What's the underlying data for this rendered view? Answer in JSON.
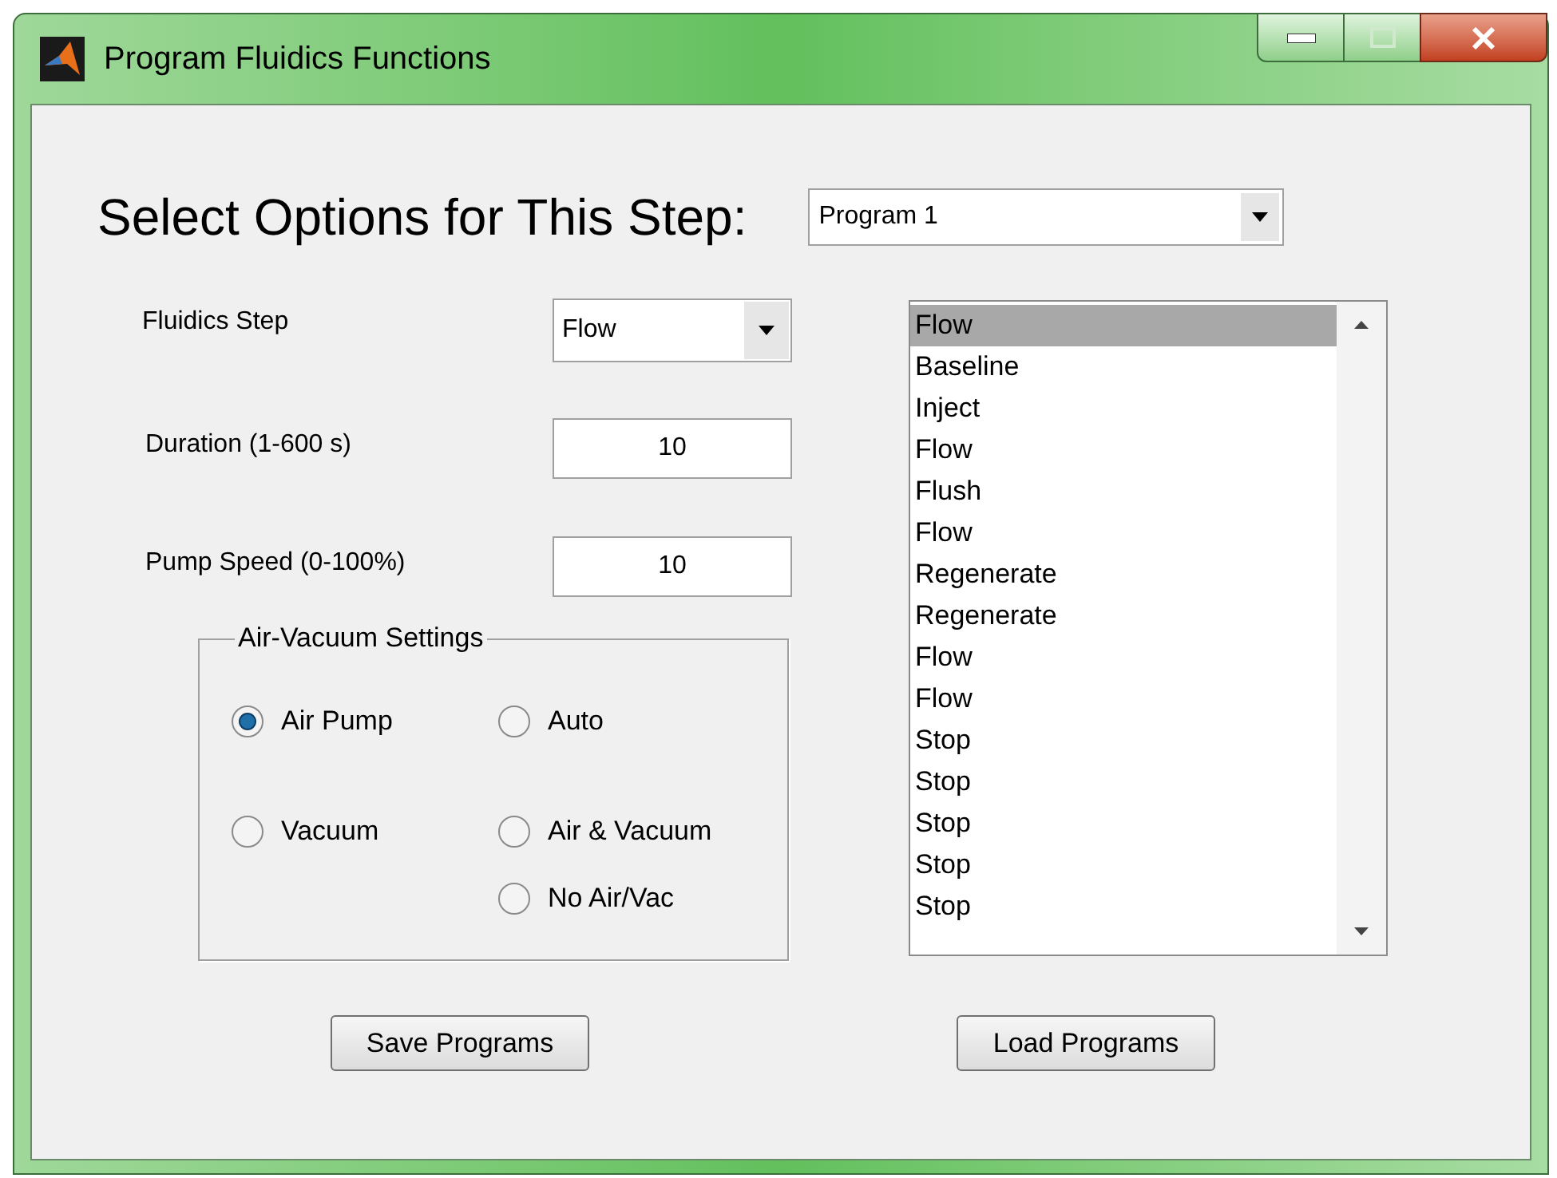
{
  "window": {
    "title": "Program Fluidics Functions"
  },
  "heading": "Select Options for This Step:",
  "program_dropdown": {
    "value": "Program 1"
  },
  "fluidics_step": {
    "label": "Fluidics Step",
    "value": "Flow"
  },
  "duration": {
    "label": "Duration (1-600 s)",
    "value": "10"
  },
  "pump_speed": {
    "label": "Pump Speed (0-100%)",
    "value": "10"
  },
  "air_vacuum_settings": {
    "title": "Air-Vacuum Settings",
    "columns": [
      [
        {
          "label": "Air Pump",
          "selected": true
        },
        {
          "label": "Vacuum",
          "selected": false
        }
      ],
      [
        {
          "label": "Auto",
          "selected": false
        },
        {
          "label": "Air & Vacuum",
          "selected": false
        },
        {
          "label": "No Air/Vac",
          "selected": false
        }
      ]
    ]
  },
  "steps_list": [
    {
      "label": "Flow",
      "selected": true
    },
    {
      "label": "Baseline",
      "selected": false
    },
    {
      "label": "Inject",
      "selected": false
    },
    {
      "label": "Flow",
      "selected": false
    },
    {
      "label": "Flush",
      "selected": false
    },
    {
      "label": "Flow",
      "selected": false
    },
    {
      "label": "Regenerate",
      "selected": false
    },
    {
      "label": "Regenerate",
      "selected": false
    },
    {
      "label": "Flow",
      "selected": false
    },
    {
      "label": "Flow",
      "selected": false
    },
    {
      "label": "Stop",
      "selected": false
    },
    {
      "label": "Stop",
      "selected": false
    },
    {
      "label": "Stop",
      "selected": false
    },
    {
      "label": "Stop",
      "selected": false
    },
    {
      "label": "Stop",
      "selected": false
    }
  ],
  "buttons": [
    "Save Programs",
    "Load Programs"
  ]
}
